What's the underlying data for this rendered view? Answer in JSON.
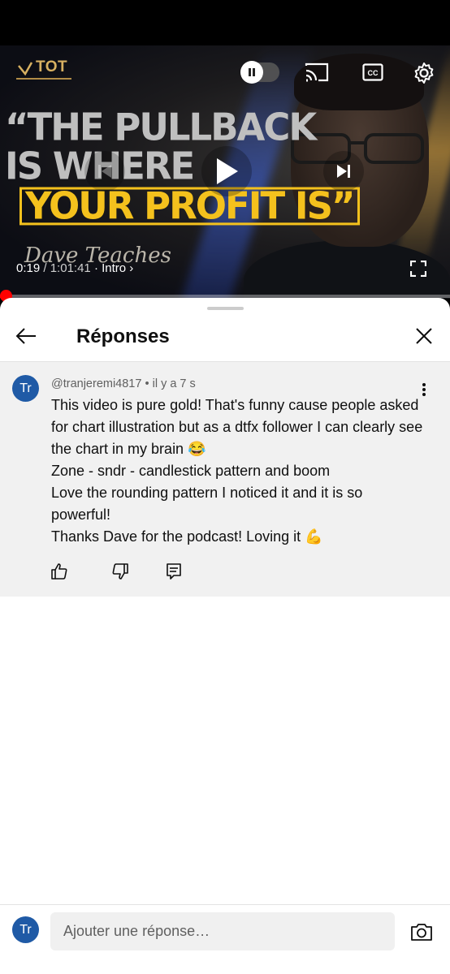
{
  "player": {
    "logo_text": "TOT",
    "quote_line1": "“THE PULLBACK",
    "quote_line2": "IS WHERE",
    "quote_line3": "YOUR PROFIT IS”",
    "signature": "Dave Teaches",
    "current_time": "0:19",
    "duration": "1:01:41",
    "chapter": "Intro",
    "progress_fraction": 0.005,
    "accent_color": "#ff0000"
  },
  "sheet": {
    "title": "Réponses",
    "back_icon": "arrow-left-icon",
    "close_icon": "close-icon"
  },
  "comment": {
    "avatar_initials": "Tr",
    "author": "@tranjeremi4817",
    "age": "il y a 7 s",
    "lines": [
      "This video is pure gold! That's funny cause people asked for chart illustration but as a dtfx follower I can clearly see the chart in my brain 😂",
      "Zone - sndr - candlestick pattern and boom",
      "Love the rounding pattern I noticed it and it is so powerful!",
      "Thanks Dave for the podcast! Loving it 💪"
    ],
    "actions": [
      "thumb-up-icon",
      "thumb-down-icon",
      "reply-icon"
    ]
  },
  "reply_bar": {
    "avatar_initials": "Tr",
    "placeholder": "Ajouter une réponse…",
    "camera_icon": "camera-icon"
  },
  "colors": {
    "avatar_bg": "#1f5aa6",
    "comment_bg": "#f1f1f1",
    "quote_yellow": "#f4c11d"
  }
}
